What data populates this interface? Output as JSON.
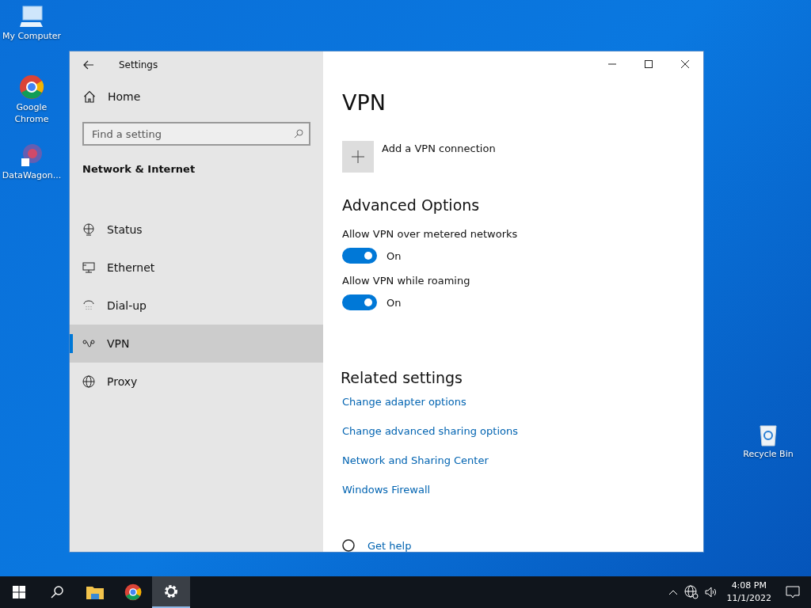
{
  "desktop_icons": [
    {
      "label": "My Computer",
      "kind": "computer"
    },
    {
      "label": "Google Chrome",
      "kind": "chrome"
    },
    {
      "label": "DataWagon...",
      "kind": "app"
    },
    {
      "label": "Recycle Bin",
      "kind": "recycle"
    }
  ],
  "window": {
    "title": "Settings"
  },
  "sidebar": {
    "home": "Home",
    "search": {
      "placeholder": "Find a setting"
    },
    "section": "Network & Internet",
    "items": [
      {
        "label": "Status",
        "kind": "status",
        "selected": false
      },
      {
        "label": "Ethernet",
        "kind": "ethernet",
        "selected": false
      },
      {
        "label": "Dial-up",
        "kind": "dialup",
        "selected": false
      },
      {
        "label": "VPN",
        "kind": "vpn",
        "selected": true
      },
      {
        "label": "Proxy",
        "kind": "proxy",
        "selected": false
      }
    ]
  },
  "content": {
    "heading": "VPN",
    "add_label": "Add a VPN connection",
    "advanced_title": "Advanced Options",
    "toggles": [
      {
        "label": "Allow VPN over metered networks",
        "on": true,
        "state_text": "On"
      },
      {
        "label": "Allow VPN while roaming",
        "on": true,
        "state_text": "On"
      }
    ],
    "related_title": "Related settings",
    "links": [
      "Change adapter options",
      "Change advanced sharing options",
      "Network and Sharing Center",
      "Windows Firewall"
    ],
    "help": "Get help"
  },
  "taskbar": {
    "apps": [
      {
        "kind": "search",
        "active": false
      },
      {
        "kind": "folder",
        "active": false
      },
      {
        "kind": "chrome",
        "active": false
      },
      {
        "kind": "settings",
        "active": true
      }
    ],
    "time": "4:08 PM",
    "date": "11/1/2022"
  }
}
